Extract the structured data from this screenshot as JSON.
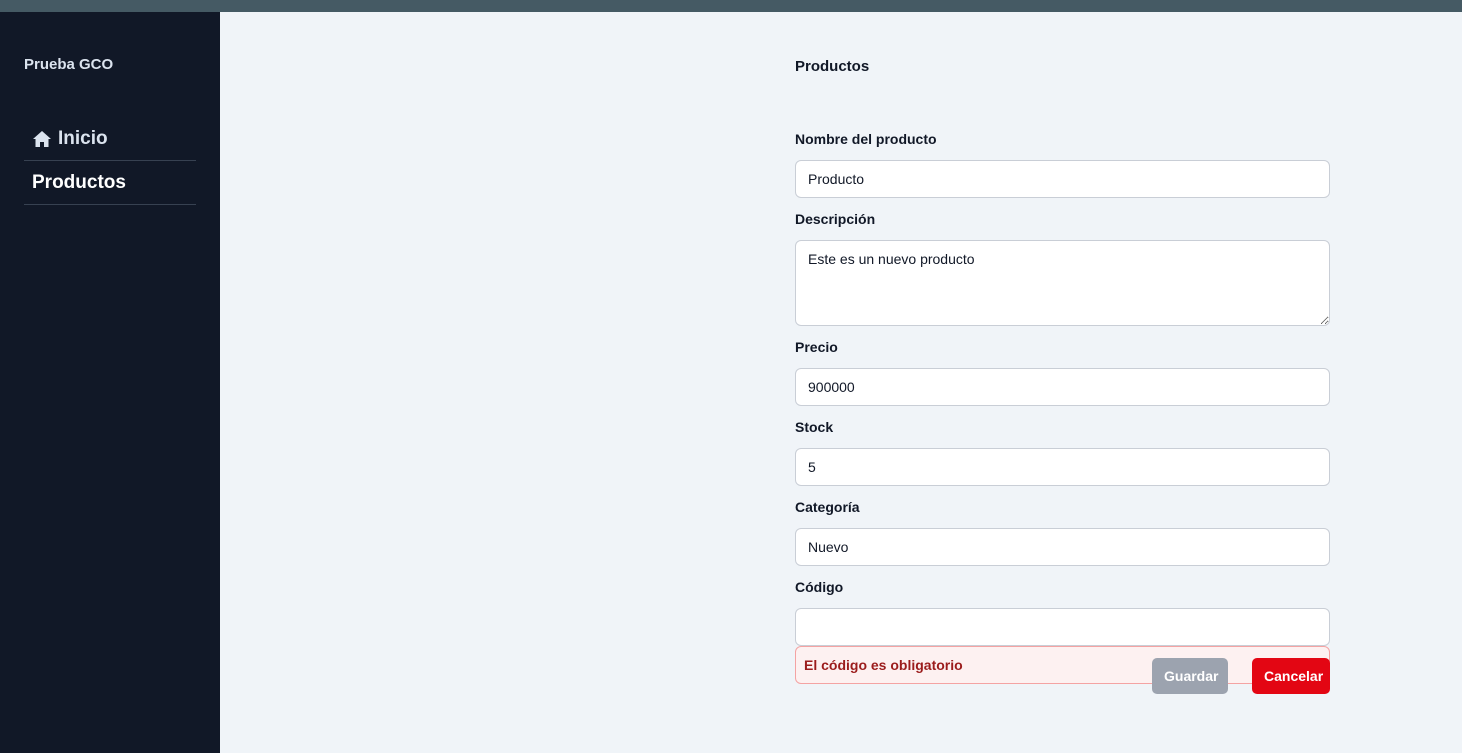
{
  "sidebar": {
    "brand": "Prueba GCO",
    "items": [
      {
        "label": "Inicio",
        "icon": "home-icon"
      },
      {
        "label": "Productos"
      }
    ]
  },
  "main": {
    "title": "Productos"
  },
  "form": {
    "name_label": "Nombre del producto",
    "name_value": "Producto",
    "description_label": "Descripción",
    "description_value": "Este es un nuevo producto",
    "price_label": "Precio",
    "price_value": "900000",
    "stock_label": "Stock",
    "stock_value": "5",
    "category_label": "Categoría",
    "category_value": "Nuevo",
    "code_label": "Código",
    "code_value": "",
    "code_error": "El código es obligatorio"
  },
  "actions": {
    "save_label": "Guardar",
    "cancel_label": "Cancelar"
  },
  "colors": {
    "sidebar_bg": "#111827",
    "topbar_bg": "#455a64",
    "page_bg": "#f0f4f8",
    "save_disabled": "#9ca3af",
    "cancel": "#e30613",
    "error_text": "#9b1c1c"
  }
}
